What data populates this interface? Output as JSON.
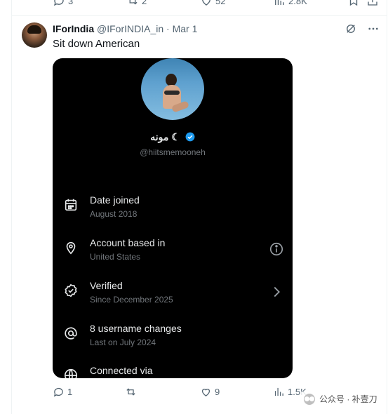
{
  "top_actions": {
    "replies": "3",
    "reposts": "2",
    "likes": "52",
    "views": "2.8K"
  },
  "post": {
    "display_name": "IForIndia",
    "handle": "@IForINDIA_in",
    "separator": " · ",
    "date": "Mar 1",
    "text": "Sit down American"
  },
  "card": {
    "display_name": "مونه ☾",
    "handle": "@hiitsmemooneh",
    "rows": [
      {
        "title": "Date joined",
        "sub": "August 2018",
        "icon": "calendar-icon"
      },
      {
        "title": "Account based in",
        "sub": "United States",
        "icon": "location-pin-icon"
      },
      {
        "title": "Verified",
        "sub": "Since December 2025",
        "icon": "verified-check-icon"
      },
      {
        "title": "8 username changes",
        "sub": "Last on July 2024",
        "icon": "at-sign-icon"
      },
      {
        "title": "Connected via",
        "sub": "",
        "icon": "globe-icon"
      }
    ]
  },
  "bottom_actions": {
    "replies": "1",
    "reposts": "",
    "likes": "9",
    "views": "1.5K"
  },
  "watermark": {
    "text": "公众号 · 补壹刀"
  },
  "colors": {
    "accent": "#1d9bf0",
    "text": "#0f1419",
    "muted": "#536471",
    "card_bg": "#000000"
  }
}
